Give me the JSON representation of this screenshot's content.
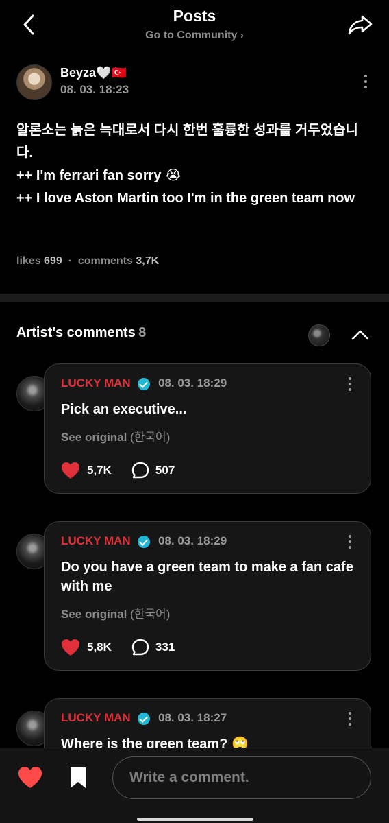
{
  "header": {
    "title": "Posts",
    "subtitle": "Go to Community",
    "back_icon": "chevron-left-icon",
    "share_icon": "share-icon"
  },
  "post": {
    "author": "Beyza🤍🇹🇷",
    "date": "08. 03. 18:23",
    "body_lines": [
      "알론소는 늙은 늑대로서 다시 한번 훌륭한 성과를 거두었습니다.",
      "++ I'm ferrari fan sorry 😭",
      "++ I love Aston Martin too I'm in the green team now"
    ],
    "likes_label": "likes",
    "likes": "699",
    "separator": "·",
    "comments_label": "comments",
    "comments": "3,7K"
  },
  "artist_section": {
    "title": "Artist's comments",
    "count": "8"
  },
  "comments": [
    {
      "name": "LUCKY MAN",
      "date": "08. 03. 18:29",
      "text": "Pick an executive...",
      "see_original": "See original",
      "lang": "(한국어)",
      "likes": "5,7K",
      "replies": "507"
    },
    {
      "name": "LUCKY MAN",
      "date": "08. 03. 18:29",
      "text": "Do you have a green team to make a fan cafe with me",
      "see_original": "See original",
      "lang": "(한국어)",
      "likes": "5,8K",
      "replies": "331"
    },
    {
      "name": "LUCKY MAN",
      "date": "08. 03. 18:27",
      "text": "Where is the green team? 🙄"
    }
  ],
  "bottom_bar": {
    "comment_placeholder": "Write a comment."
  },
  "colors": {
    "accent_red": "#e0303a",
    "verified": "#21b8d8",
    "background": "#000000"
  }
}
